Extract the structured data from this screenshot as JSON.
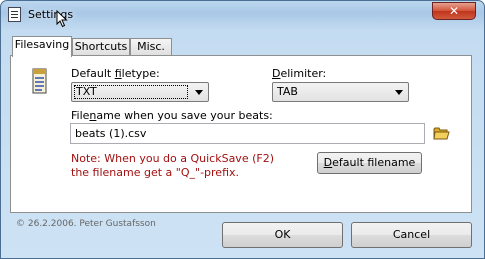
{
  "window": {
    "title": "Settings",
    "close_glyph": "✕"
  },
  "tabs": [
    {
      "label": "Filesaving",
      "active": true
    },
    {
      "label": "Shortcuts",
      "active": false
    },
    {
      "label": "Misc.",
      "active": false
    }
  ],
  "filesaving": {
    "filetype_label_pre": "Default ",
    "filetype_label_u": "f",
    "filetype_label_post": "iletype:",
    "filetype_value": "TXT",
    "delimiter_label_pre": "",
    "delimiter_label_u": "D",
    "delimiter_label_post": "elimiter:",
    "delimiter_value": "TAB",
    "filename_label_pre": "File",
    "filename_label_u": "n",
    "filename_label_post": "ame when you save your beats:",
    "filename_value": "beats (1).csv",
    "note_line1": "Note: When you do a QuickSave (F2)",
    "note_line2": "the filename get a \"Q_\"-prefix.",
    "default_btn_u": "D",
    "default_btn_post": "efault filename"
  },
  "footer": {
    "copyright": "© 26.2.2006. Peter Gustafsson",
    "ok_label": "OK",
    "cancel_label": "Cancel"
  },
  "icons": {
    "app": "settings-window-icon",
    "doc": "document-icon",
    "folder": "folder-icon",
    "close": "close-icon",
    "cursor": "mouse-cursor-icon"
  },
  "colors": {
    "note": "#a21010",
    "close_button": "#c8452b",
    "folder": "#e6c04a"
  }
}
